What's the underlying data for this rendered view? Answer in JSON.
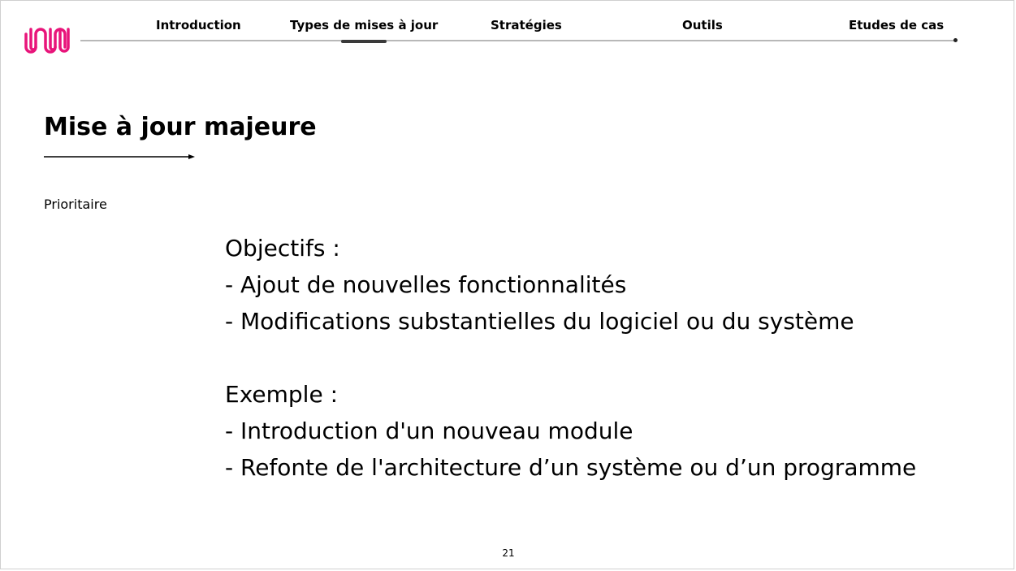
{
  "colors": {
    "accent": "#e8147a",
    "text": "#000000",
    "divider": "#b8b8b8",
    "active_indicator": "#3a3a3a"
  },
  "logo": {
    "icon": "wavy-logo-icon"
  },
  "nav": {
    "items": [
      {
        "label": "Introduction",
        "active": false
      },
      {
        "label": "Types de mises à jour",
        "active": true
      },
      {
        "label": "Stratégies",
        "active": false
      },
      {
        "label": "Outils",
        "active": false
      },
      {
        "label": "Etudes de cas",
        "active": false
      }
    ]
  },
  "slide": {
    "title": "Mise à jour majeure",
    "tag": "Prioritaire",
    "objectives": {
      "heading": "Objectifs :",
      "items": [
        "- Ajout de nouvelles fonctionnalités",
        "- Modifications substantielles du logiciel ou du système"
      ]
    },
    "examples": {
      "heading": "Exemple :",
      "items": [
        "- Introduction d'un nouveau module",
        "- Refonte de l'architecture d’un système ou d’un programme"
      ]
    },
    "page_number": "21"
  }
}
